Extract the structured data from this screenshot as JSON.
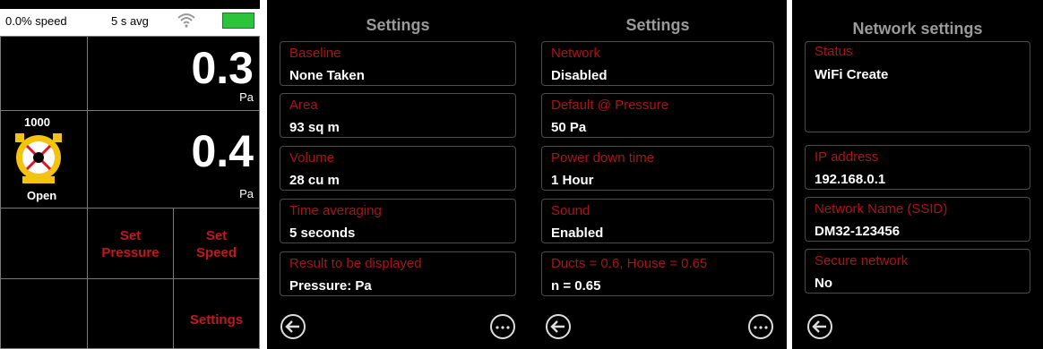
{
  "gauge_panel": {
    "status": {
      "speed_text": "0.0% speed",
      "avg_text": "5 s avg",
      "battery_color": "#2cc43a"
    },
    "reading1": {
      "value": "0.3",
      "unit": "Pa"
    },
    "reading2": {
      "value": "0.4",
      "unit": "Pa"
    },
    "fan": {
      "number": "1000",
      "state": "Open",
      "icon": "fan-ring-icon"
    },
    "buttons": {
      "set_pressure": [
        "Set",
        "Pressure"
      ],
      "set_speed": [
        "Set",
        "Speed"
      ],
      "settings": "Settings"
    }
  },
  "settings_panel_1": {
    "title": "Settings",
    "rows": [
      {
        "label": "Baseline",
        "value": "None Taken"
      },
      {
        "label": "Area",
        "value": "93 sq m"
      },
      {
        "label": "Volume",
        "value": "28 cu m"
      },
      {
        "label": "Time averaging",
        "value": "5 seconds"
      },
      {
        "label": "Result to be displayed",
        "value": "Pressure: Pa"
      }
    ]
  },
  "settings_panel_2": {
    "title": "Settings",
    "rows": [
      {
        "label": "Network",
        "value": "Disabled"
      },
      {
        "label": "Default @ Pressure",
        "value": "50 Pa"
      },
      {
        "label": "Power down time",
        "value": "1 Hour"
      },
      {
        "label": "Sound",
        "value": "Enabled"
      },
      {
        "label": "Ducts = 0.6, House = 0.65",
        "value": "n = 0.65"
      }
    ]
  },
  "network_panel": {
    "title": "Network settings",
    "status": {
      "label": "Status",
      "value": "WiFi Create"
    },
    "rows": [
      {
        "label": "IP address",
        "value": "192.168.0.1"
      },
      {
        "label": "Network Name (SSID)",
        "value": "DM32-123456"
      },
      {
        "label": "Secure network",
        "value": "No"
      }
    ]
  },
  "colors": {
    "accent_red": "#c0191e",
    "label_red": "#a8141a",
    "title_gray": "#9a9a9a",
    "fan_yellow": "#f3c40f"
  }
}
